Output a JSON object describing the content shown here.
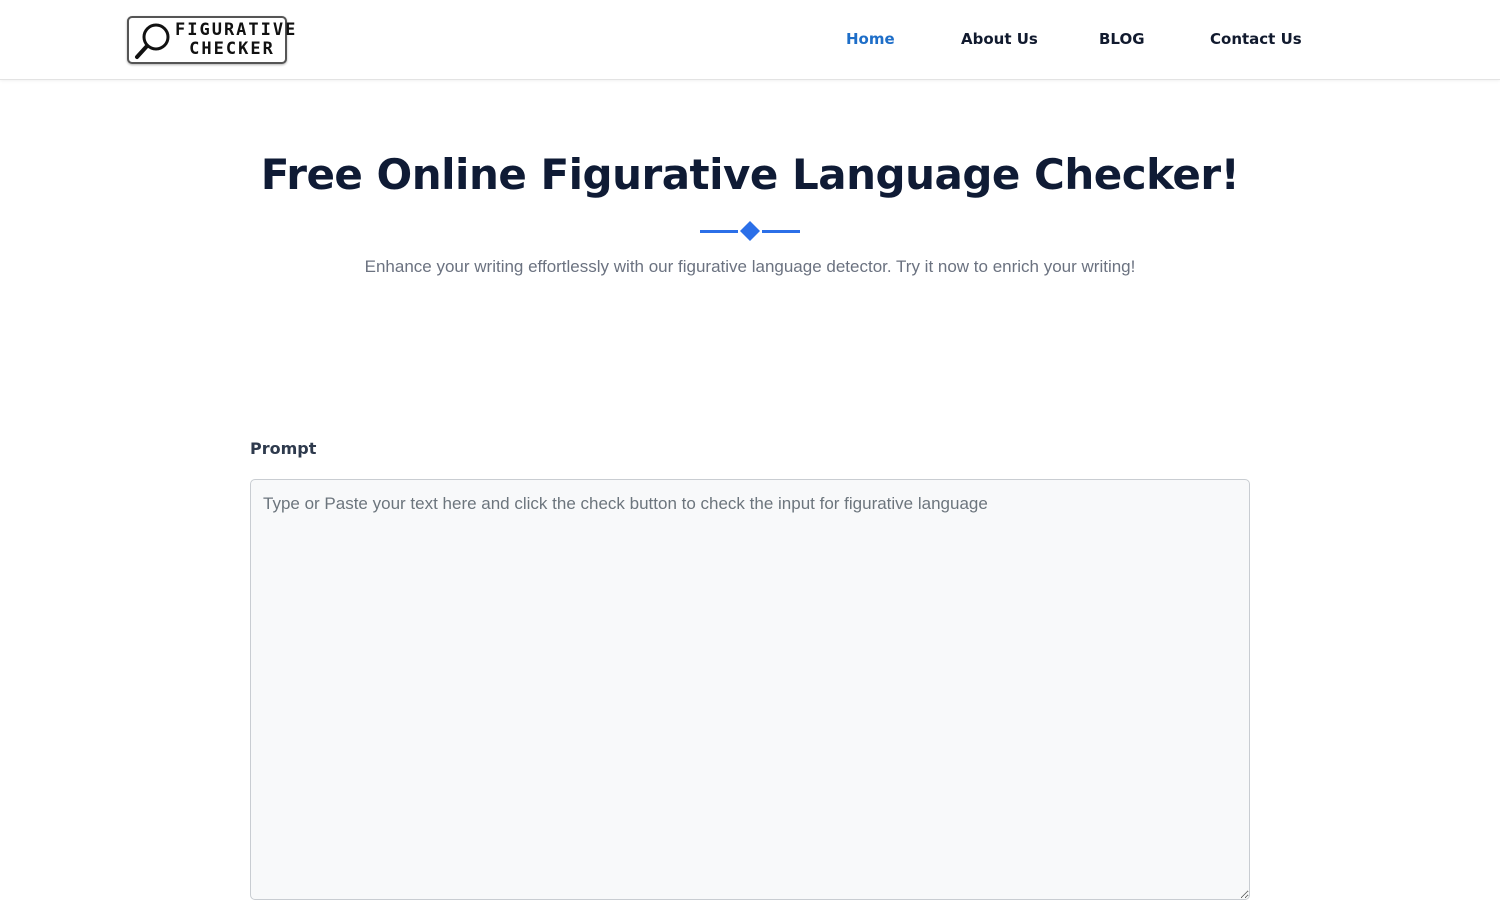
{
  "header": {
    "logo": {
      "line1": "FIGURATIVE",
      "line2": "CHECKER",
      "icon": "magnifier-icon"
    },
    "nav": [
      {
        "label": "Home",
        "active": true
      },
      {
        "label": "About Us",
        "active": false
      },
      {
        "label": "BLOG",
        "active": false
      },
      {
        "label": "Contact Us",
        "active": false
      }
    ],
    "accent_color": "#1e6ec8"
  },
  "hero": {
    "title": "Free Online Figurative Language Checker!",
    "divider_icon": "diamond-divider-icon",
    "divider_color": "#2b6fe8",
    "subtitle": "Enhance your writing effortlessly with our figurative language detector. Try it now to enrich your writing!"
  },
  "form": {
    "prompt_label": "Prompt",
    "prompt_value": "",
    "prompt_placeholder": "Type or Paste your text here and click the check button to check the input for figurative language"
  }
}
